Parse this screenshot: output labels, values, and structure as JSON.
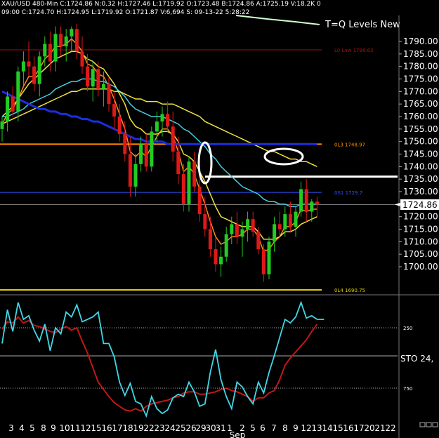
{
  "header": {
    "line1": "XAU/USD  480-Min  C:1724.86  N:0.32  H:1727.46  L:1719.92  O:1723.48  B:1724.86  A:1725.19  V:18.2K  0",
    "line2": "09:00  C:1724.70  H:1724.95  L:1719.92  O:1721.87  V:6,694  S:  09-13-22  5:28:22"
  },
  "title_text": "T=Q Levels New",
  "last_price_label": "1724.86",
  "sto_label": "STO  24,",
  "chart_data": {
    "type": "candlestick",
    "price_axis": {
      "ylim": [
        1690,
        1800
      ],
      "ticks": [
        1700,
        1705,
        1710,
        1715,
        1720,
        1725,
        1730,
        1735,
        1740,
        1745,
        1750,
        1755,
        1760,
        1765,
        1770,
        1775,
        1780,
        1785,
        1790
      ],
      "tick_labels": [
        "1700.00",
        "1705.00",
        "1710.00",
        "1715.00",
        "1720.00",
        "1725.00",
        "1730.00",
        "1735.00",
        "1740.00",
        "1745.00",
        "1750.00",
        "1755.00",
        "1760.00",
        "1765.00",
        "1770.00",
        "1775.00",
        "1780.00",
        "1785.00",
        "1790.00"
      ]
    },
    "x_axis": {
      "day_labels": [
        "3",
        "4",
        "5",
        "8",
        "9",
        "10",
        "11",
        "12",
        "15",
        "16",
        "17",
        "18",
        "19",
        "22",
        "23",
        "24",
        "25",
        "26",
        "29",
        "30",
        "31",
        "1",
        "2",
        "5",
        "6",
        "7",
        "8",
        "9",
        "12",
        "13",
        "14",
        "15",
        "16",
        "17",
        "20",
        "21",
        "22"
      ],
      "month_label": "Sep"
    },
    "levels": [
      {
        "label": "L0 Low 1786.63",
        "value": 1786.63,
        "color": "#a01010"
      },
      {
        "label": "0L3 1748.97",
        "value": 1748.97,
        "color": "#ff8c00"
      },
      {
        "label": "0S1 1729.7",
        "value": 1729.7,
        "color": "#3050ff"
      },
      {
        "label": "0L4 1690.75",
        "value": 1690.75,
        "color": "#e0d000"
      },
      {
        "label": "",
        "value": 1736,
        "color": "#ffffff"
      },
      {
        "label": "",
        "value": 1724.86,
        "color": "#888888"
      }
    ],
    "candles": [
      [
        1755,
        1760,
        1750,
        1758
      ],
      [
        1758,
        1770,
        1754,
        1768
      ],
      [
        1768,
        1772,
        1760,
        1762
      ],
      [
        1762,
        1780,
        1758,
        1778
      ],
      [
        1778,
        1786,
        1772,
        1782
      ],
      [
        1782,
        1790,
        1776,
        1780
      ],
      [
        1780,
        1784,
        1770,
        1773
      ],
      [
        1773,
        1786,
        1768,
        1784
      ],
      [
        1784,
        1792,
        1780,
        1789
      ],
      [
        1789,
        1794,
        1778,
        1782
      ],
      [
        1782,
        1796,
        1778,
        1793
      ],
      [
        1793,
        1796,
        1784,
        1788
      ],
      [
        1788,
        1795,
        1782,
        1792
      ],
      [
        1792,
        1796,
        1786,
        1795
      ],
      [
        1795,
        1797,
        1783,
        1786
      ],
      [
        1786,
        1792,
        1777,
        1780
      ],
      [
        1780,
        1785,
        1770,
        1772
      ],
      [
        1772,
        1782,
        1766,
        1779
      ],
      [
        1779,
        1782,
        1768,
        1771
      ],
      [
        1771,
        1778,
        1764,
        1773
      ],
      [
        1773,
        1776,
        1762,
        1765
      ],
      [
        1765,
        1770,
        1755,
        1760
      ],
      [
        1760,
        1765,
        1750,
        1753
      ],
      [
        1753,
        1758,
        1742,
        1745
      ],
      [
        1745,
        1752,
        1728,
        1732
      ],
      [
        1732,
        1745,
        1728,
        1741
      ],
      [
        1741,
        1752,
        1738,
        1749
      ],
      [
        1749,
        1753,
        1738,
        1740
      ],
      [
        1740,
        1756,
        1738,
        1754
      ],
      [
        1754,
        1762,
        1750,
        1758
      ],
      [
        1758,
        1764,
        1752,
        1761
      ],
      [
        1761,
        1766,
        1754,
        1756
      ],
      [
        1756,
        1762,
        1742,
        1746
      ],
      [
        1746,
        1752,
        1733,
        1737
      ],
      [
        1737,
        1741,
        1722,
        1725
      ],
      [
        1725,
        1744,
        1722,
        1742
      ],
      [
        1742,
        1746,
        1730,
        1732
      ],
      [
        1732,
        1735,
        1718,
        1721
      ],
      [
        1721,
        1728,
        1712,
        1715
      ],
      [
        1715,
        1720,
        1704,
        1707
      ],
      [
        1707,
        1712,
        1698,
        1701
      ],
      [
        1701,
        1708,
        1696,
        1704
      ],
      [
        1704,
        1716,
        1702,
        1713
      ],
      [
        1713,
        1720,
        1709,
        1717
      ],
      [
        1717,
        1722,
        1709,
        1712
      ],
      [
        1712,
        1718,
        1704,
        1715
      ],
      [
        1715,
        1722,
        1710,
        1719
      ],
      [
        1719,
        1722,
        1712,
        1714
      ],
      [
        1714,
        1716,
        1705,
        1707
      ],
      [
        1707,
        1709,
        1694,
        1697
      ],
      [
        1697,
        1712,
        1695,
        1710
      ],
      [
        1710,
        1720,
        1706,
        1717
      ],
      [
        1717,
        1722,
        1712,
        1715
      ],
      [
        1715,
        1724,
        1712,
        1721
      ],
      [
        1721,
        1726,
        1714,
        1716
      ],
      [
        1716,
        1724,
        1712,
        1722
      ],
      [
        1722,
        1734,
        1720,
        1731
      ],
      [
        1731,
        1735,
        1718,
        1722
      ],
      [
        1722,
        1727,
        1718,
        1726
      ],
      [
        1726,
        1728,
        1720,
        1724.86
      ]
    ],
    "moving_averages": [
      {
        "color": "#ff8c1a",
        "values": [
          1757,
          1761,
          1763,
          1767,
          1772,
          1776,
          1776,
          1779,
          1783,
          1785,
          1788,
          1788,
          1789,
          1791,
          1789,
          1786,
          1781,
          1780,
          1777,
          1776,
          1772,
          1767,
          1761,
          1755,
          1746,
          1744,
          1746,
          1744,
          1748,
          1752,
          1755,
          1755,
          1752,
          1746,
          1738,
          1740,
          1737,
          1731,
          1725,
          1718,
          1712,
          1709,
          1710,
          1712,
          1712,
          1713,
          1715,
          1715,
          1712,
          1706,
          1707,
          1710,
          1712,
          1716,
          1716,
          1718,
          1723,
          1722,
          1723,
          1723
        ]
      },
      {
        "color": "#f0e040",
        "values": [
          1760,
          1762,
          1764,
          1767,
          1770,
          1773,
          1775,
          1777,
          1779,
          1781,
          1783,
          1784,
          1785,
          1786,
          1786,
          1785,
          1783,
          1782,
          1780,
          1779,
          1776,
          1773,
          1769,
          1765,
          1759,
          1756,
          1755,
          1753,
          1753,
          1753,
          1754,
          1754,
          1753,
          1750,
          1745,
          1744,
          1742,
          1738,
          1734,
          1729,
          1724,
          1720,
          1719,
          1718,
          1717,
          1716,
          1716,
          1716,
          1714,
          1711,
          1711,
          1711,
          1712,
          1714,
          1714,
          1715,
          1717,
          1718,
          1719,
          1720
        ]
      },
      {
        "color": "#40d0e0",
        "values": [
          1760,
          1760,
          1761,
          1762,
          1763,
          1765,
          1766,
          1767,
          1768,
          1769,
          1771,
          1772,
          1773,
          1774,
          1774,
          1775,
          1775,
          1775,
          1774,
          1774,
          1773,
          1772,
          1770,
          1768,
          1765,
          1763,
          1762,
          1761,
          1760,
          1760,
          1760,
          1759,
          1758,
          1757,
          1755,
          1754,
          1752,
          1750,
          1748,
          1745,
          1743,
          1740,
          1738,
          1736,
          1734,
          1732,
          1731,
          1730,
          1729,
          1727,
          1726,
          1726,
          1725,
          1725,
          1724,
          1724,
          1725,
          1725,
          1725,
          1725
        ]
      },
      {
        "color": "#f0e040",
        "values": [
          1757,
          1758,
          1759,
          1760,
          1761,
          1762,
          1763,
          1764,
          1765,
          1766,
          1767,
          1768,
          1769,
          1770,
          1770,
          1771,
          1771,
          1771,
          1771,
          1771,
          1771,
          1770,
          1770,
          1769,
          1768,
          1767,
          1767,
          1766,
          1766,
          1766,
          1765,
          1765,
          1765,
          1764,
          1763,
          1762,
          1761,
          1760,
          1758,
          1757,
          1756,
          1755,
          1754,
          1753,
          1752,
          1751,
          1750,
          1749,
          1748,
          1747,
          1746,
          1746,
          1745,
          1744,
          1743,
          1743,
          1742,
          1742,
          1741,
          1740
        ]
      },
      {
        "color": "#1a2ee0",
        "values": [
          1770,
          1769,
          1768,
          1767,
          1766,
          1765,
          1764,
          1763,
          1763,
          1762,
          1762,
          1761,
          1761,
          1760,
          1760,
          1759,
          1759,
          1758,
          1758,
          1757,
          1756,
          1755,
          1754,
          1753,
          1752,
          1751,
          1751,
          1750,
          1750,
          1750,
          1750,
          1749,
          1749,
          1749,
          1749,
          1749,
          1749,
          1749,
          1749,
          1749,
          1749,
          1749,
          1749,
          1749,
          1749,
          1749,
          1749,
          1749,
          1749,
          1749,
          1749,
          1749,
          1749,
          1749,
          1749,
          1749,
          1749,
          1749,
          1749,
          1749
        ]
      }
    ],
    "oscillator": {
      "ylim": [
        0,
        1000
      ],
      "levels": [
        250,
        750
      ],
      "level_labels": [
        "250",
        "750"
      ],
      "fast": [
        380,
        100,
        280,
        40,
        180,
        150,
        270,
        360,
        220,
        440,
        250,
        300,
        120,
        160,
        60,
        200,
        180,
        160,
        120,
        380,
        380,
        490,
        700,
        810,
        710,
        860,
        880,
        980,
        820,
        920,
        960,
        930,
        830,
        800,
        820,
        700,
        780,
        900,
        880,
        620,
        430,
        680,
        820,
        920,
        700,
        740,
        820,
        880,
        700,
        790,
        620,
        480,
        330,
        180,
        210,
        160,
        40,
        170,
        150,
        180
      ],
      "slow": [
        260,
        200,
        210,
        160,
        210,
        190,
        230,
        240,
        260,
        280,
        290,
        260,
        240,
        270,
        250,
        360,
        460,
        580,
        700,
        760,
        820,
        870,
        900,
        930,
        940,
        920,
        940,
        900,
        880,
        870,
        860,
        850,
        830,
        820,
        790,
        780,
        780,
        800,
        800,
        790,
        780,
        760,
        750,
        770,
        780,
        800,
        820,
        860,
        830,
        830,
        790,
        770,
        680,
        560,
        500,
        450,
        400,
        350,
        280,
        220
      ]
    }
  }
}
